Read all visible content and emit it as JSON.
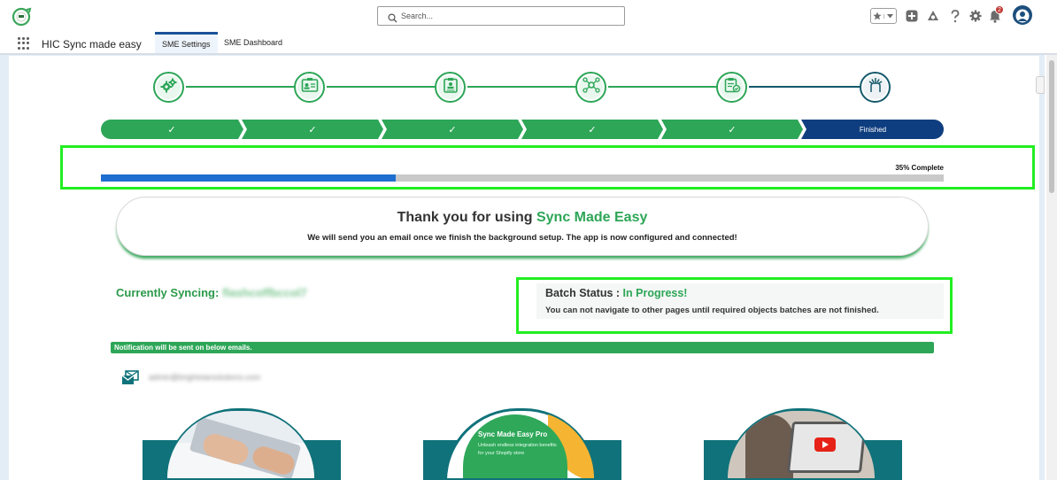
{
  "header": {
    "search_placeholder": "Search...",
    "notification_count": "2"
  },
  "app": {
    "name": "HIC Sync made easy",
    "tabs": [
      {
        "label": "SME Settings",
        "active": true
      },
      {
        "label": "SME Dashboard",
        "active": false
      }
    ]
  },
  "steps": {
    "icons": [
      "gears-icon",
      "id-card-icon",
      "clipboard-icon",
      "network-icon",
      "checklist-icon",
      "hand-icon"
    ],
    "chevrons": [
      "✓",
      "✓",
      "✓",
      "✓",
      "✓",
      "Finished"
    ]
  },
  "progress": {
    "label": "35% Complete",
    "percent": 35,
    "fill_color": "#1f6fd0"
  },
  "thanks": {
    "title_prefix": "Thank you for using",
    "title_brand": "Sync Made Easy",
    "subtitle": "We will send you an email once we finish the background setup. The app is now configured and connected!"
  },
  "syncing": {
    "label": "Currently Syncing:",
    "value": "flashcoffbccol7"
  },
  "batch": {
    "title": "Batch Status :",
    "status": "In Progress!",
    "note": "You can not navigate to other pages until required objects batches are not finished."
  },
  "notification": {
    "bar_text": "Notification will be sent on below emails.",
    "email": "admin@brightstarsolutions.com"
  },
  "promo": {
    "pro_title": "Sync Made Easy Pro",
    "pro_sub": "Unleash endless integration benefits for your Shopify store"
  },
  "colors": {
    "brand_green": "#2da657",
    "navy": "#0f3e80",
    "highlight": "#22ee22",
    "teal": "#10727a"
  }
}
